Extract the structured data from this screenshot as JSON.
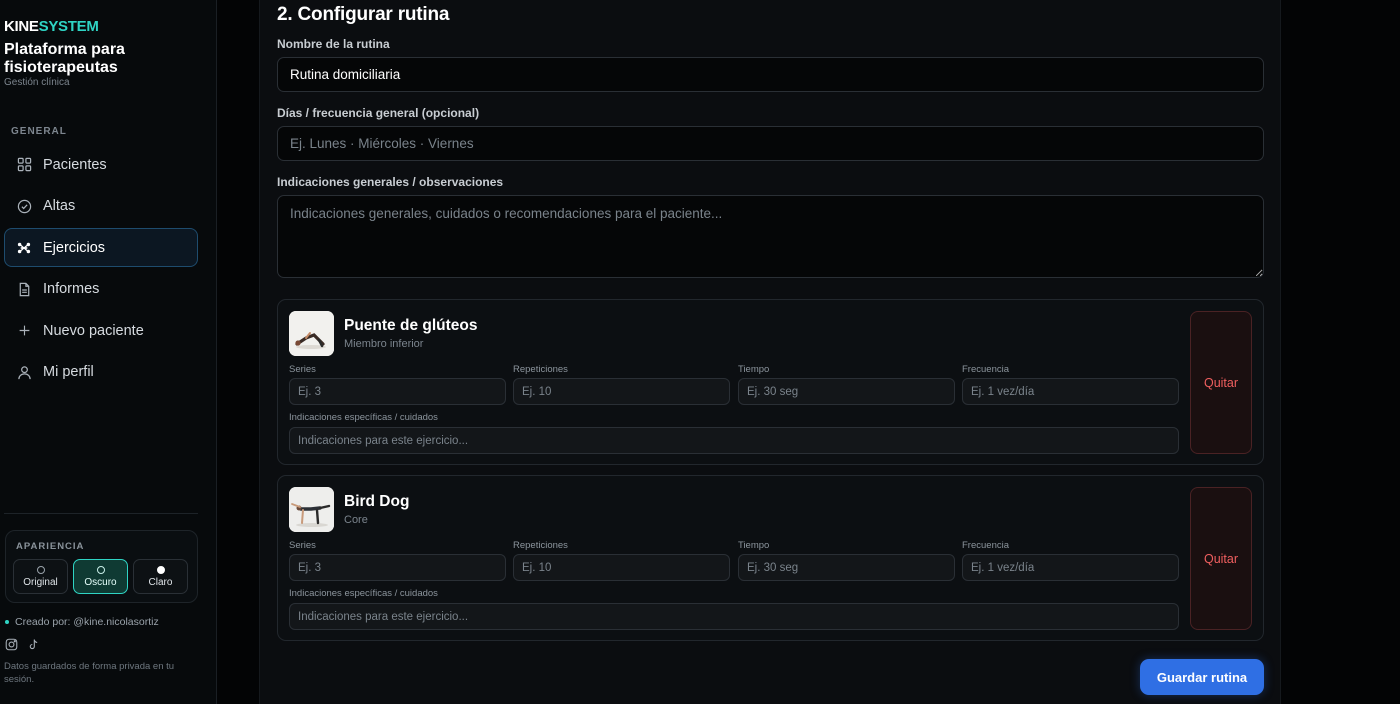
{
  "sidebar": {
    "brand_a": "KINE",
    "brand_b": "SYSTEM",
    "title": "Plataforma para fisioterapeutas",
    "subtitle": "Gestión clínica",
    "section_label": "GENERAL",
    "nav": [
      {
        "label": "Pacientes",
        "icon": "grid-icon"
      },
      {
        "label": "Altas",
        "icon": "check-circle-icon"
      },
      {
        "label": "Ejercicios",
        "icon": "exercise-icon",
        "active": true
      },
      {
        "label": "Informes",
        "icon": "document-icon"
      },
      {
        "label": "Nuevo paciente",
        "icon": "plus-icon"
      },
      {
        "label": "Mi perfil",
        "icon": "user-icon"
      }
    ],
    "appearance": {
      "label": "APARIENCIA",
      "options": [
        "Original",
        "Oscuro",
        "Claro"
      ],
      "selected": "Oscuro"
    },
    "credit": "Creado por: @kine.nicolasortiz",
    "privacy": "Datos guardados de forma privada en tu sesión."
  },
  "main": {
    "heading": "2. Configurar rutina",
    "name_label": "Nombre de la rutina",
    "name_value": "Rutina domiciliaria",
    "days_label": "Días / frecuencia general (opcional)",
    "days_placeholder": "Ej. Lunes · Miércoles · Viernes",
    "notes_label": "Indicaciones generales / observaciones",
    "notes_placeholder": "Indicaciones generales, cuidados o recomendaciones para el paciente...",
    "field_labels": {
      "series": "Series",
      "reps": "Repeticiones",
      "time": "Tiempo",
      "freq": "Frecuencia",
      "specific": "Indicaciones específicas / cuidados"
    },
    "field_placeholders": {
      "series": "Ej. 3",
      "reps": "Ej. 10",
      "time": "Ej. 30 seg",
      "freq": "Ej. 1 vez/día",
      "specific": "Indicaciones para este ejercicio..."
    },
    "exercises": [
      {
        "name": "Puente de glúteos",
        "category": "Miembro inferior",
        "remove": "Quitar"
      },
      {
        "name": "Bird Dog",
        "category": "Core",
        "remove": "Quitar"
      }
    ],
    "save_label": "Guardar rutina"
  },
  "colors": {
    "accent": "#2fd4c4",
    "primary_button": "#2f6fe4",
    "danger": "#f05f5f"
  }
}
